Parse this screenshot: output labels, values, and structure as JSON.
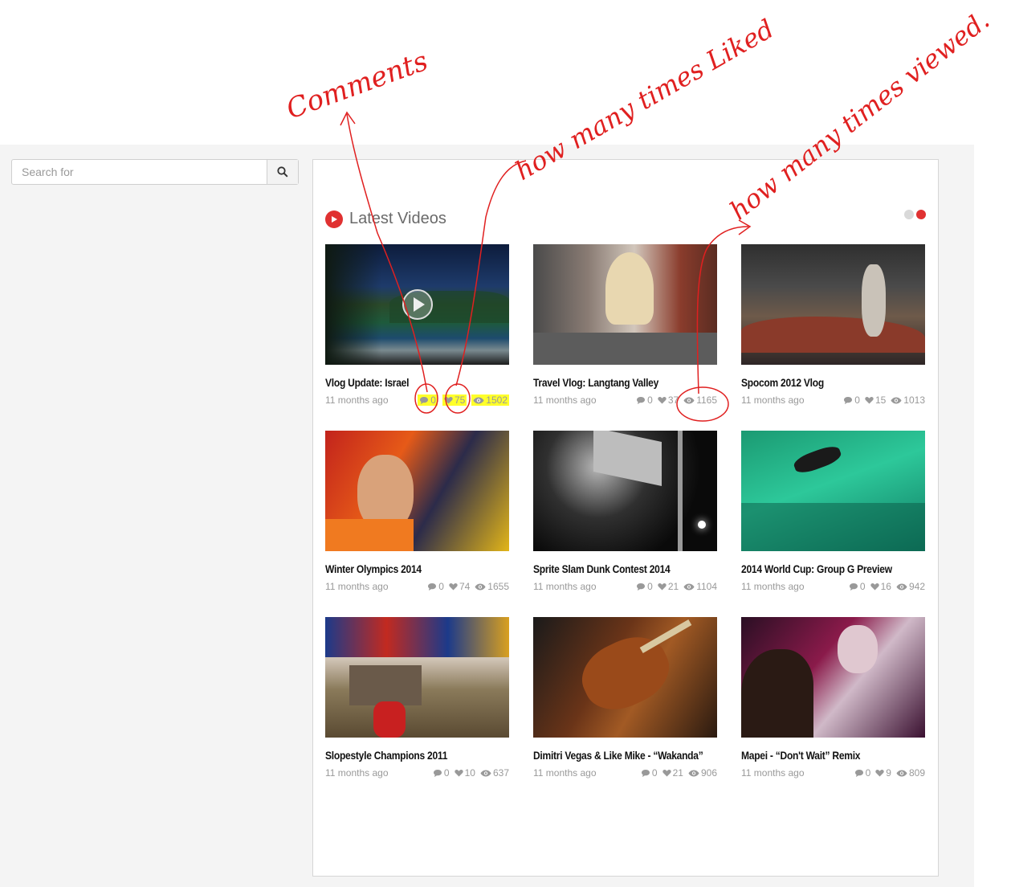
{
  "search": {
    "placeholder": "Search for"
  },
  "section": {
    "title": "Latest Videos"
  },
  "videos": [
    {
      "title": "Vlog Update: Israel",
      "age": "11 months ago",
      "comments": "0",
      "likes": "75",
      "views": "1502",
      "highlight": true
    },
    {
      "title": "Travel Vlog: Langtang Valley",
      "age": "11 months ago",
      "comments": "0",
      "likes": "37",
      "views": "1165"
    },
    {
      "title": "Spocom 2012 Vlog",
      "age": "11 months ago",
      "comments": "0",
      "likes": "15",
      "views": "1013"
    },
    {
      "title": "Winter Olympics 2014",
      "age": "11 months ago",
      "comments": "0",
      "likes": "74",
      "views": "1655"
    },
    {
      "title": "Sprite Slam Dunk Contest 2014",
      "age": "11 months ago",
      "comments": "0",
      "likes": "21",
      "views": "1104"
    },
    {
      "title": "2014 World Cup: Group G Preview",
      "age": "11 months ago",
      "comments": "0",
      "likes": "16",
      "views": "942"
    },
    {
      "title": "Slopestyle Champions 2011",
      "age": "11 months ago",
      "comments": "0",
      "likes": "10",
      "views": "637"
    },
    {
      "title": "Dimitri Vegas & Like Mike - “Wakanda”",
      "age": "11 months ago",
      "comments": "0",
      "likes": "21",
      "views": "906"
    },
    {
      "title": "Mapei - “Don't Wait” Remix",
      "age": "11 months ago",
      "comments": "0",
      "likes": "9",
      "views": "809"
    }
  ],
  "annotations": {
    "comments": "Comments",
    "liked": "how many times Liked",
    "viewed": "how many times viewed."
  },
  "colors": {
    "accent": "#e03131",
    "highlight": "#ffff2a",
    "annotation": "#e02020"
  }
}
